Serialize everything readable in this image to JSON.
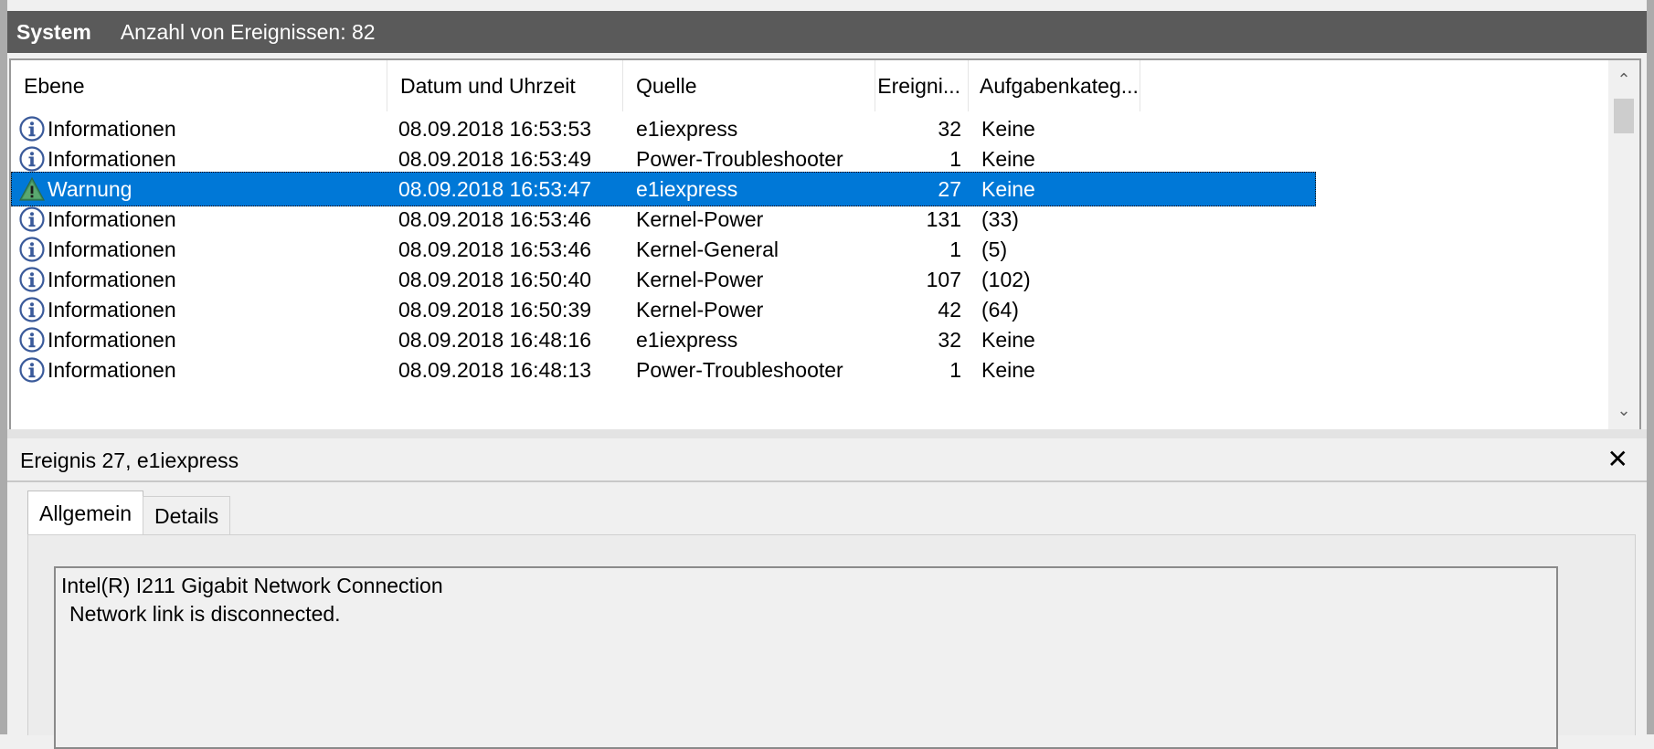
{
  "header": {
    "title": "System",
    "count_label": "Anzahl von Ereignissen: 82"
  },
  "columns": {
    "level": "Ebene",
    "datetime": "Datum und Uhrzeit",
    "source": "Quelle",
    "event_id": "Ereigni...",
    "category": "Aufgabenkateg..."
  },
  "rows": [
    {
      "icon": "info-icon",
      "level": "Informationen",
      "datetime": "08.09.2018 16:53:53",
      "source": "e1iexpress",
      "event_id": "32",
      "category": "Keine"
    },
    {
      "icon": "info-icon",
      "level": "Informationen",
      "datetime": "08.09.2018 16:53:49",
      "source": "Power-Troubleshooter",
      "event_id": "1",
      "category": "Keine"
    },
    {
      "icon": "warning-icon",
      "level": "Warnung",
      "datetime": "08.09.2018 16:53:47",
      "source": "e1iexpress",
      "event_id": "27",
      "category": "Keine",
      "selected": true
    },
    {
      "icon": "info-icon",
      "level": "Informationen",
      "datetime": "08.09.2018 16:53:46",
      "source": "Kernel-Power",
      "event_id": "131",
      "category": "(33)"
    },
    {
      "icon": "info-icon",
      "level": "Informationen",
      "datetime": "08.09.2018 16:53:46",
      "source": "Kernel-General",
      "event_id": "1",
      "category": "(5)"
    },
    {
      "icon": "info-icon",
      "level": "Informationen",
      "datetime": "08.09.2018 16:50:40",
      "source": "Kernel-Power",
      "event_id": "107",
      "category": "(102)"
    },
    {
      "icon": "info-icon",
      "level": "Informationen",
      "datetime": "08.09.2018 16:50:39",
      "source": "Kernel-Power",
      "event_id": "42",
      "category": "(64)"
    },
    {
      "icon": "info-icon",
      "level": "Informationen",
      "datetime": "08.09.2018 16:48:16",
      "source": "e1iexpress",
      "event_id": "32",
      "category": "Keine"
    },
    {
      "icon": "info-icon",
      "level": "Informationen",
      "datetime": "08.09.2018 16:48:13",
      "source": "Power-Troubleshooter",
      "event_id": "1",
      "category": "Keine"
    }
  ],
  "scrollbar": {
    "up_icon": "chevron-up-icon",
    "down_icon": "chevron-down-icon"
  },
  "detail": {
    "title": "Ereignis 27, e1iexpress",
    "close_icon": "close-icon",
    "close_glyph": "✕",
    "tabs": [
      "Allgemein",
      "Details"
    ],
    "message_line1": "Intel(R) I211 Gigabit Network Connection",
    "message_line2": "Network link is disconnected."
  },
  "colors": {
    "header_bg": "#5a5a5a",
    "selection": "#0078d7"
  }
}
